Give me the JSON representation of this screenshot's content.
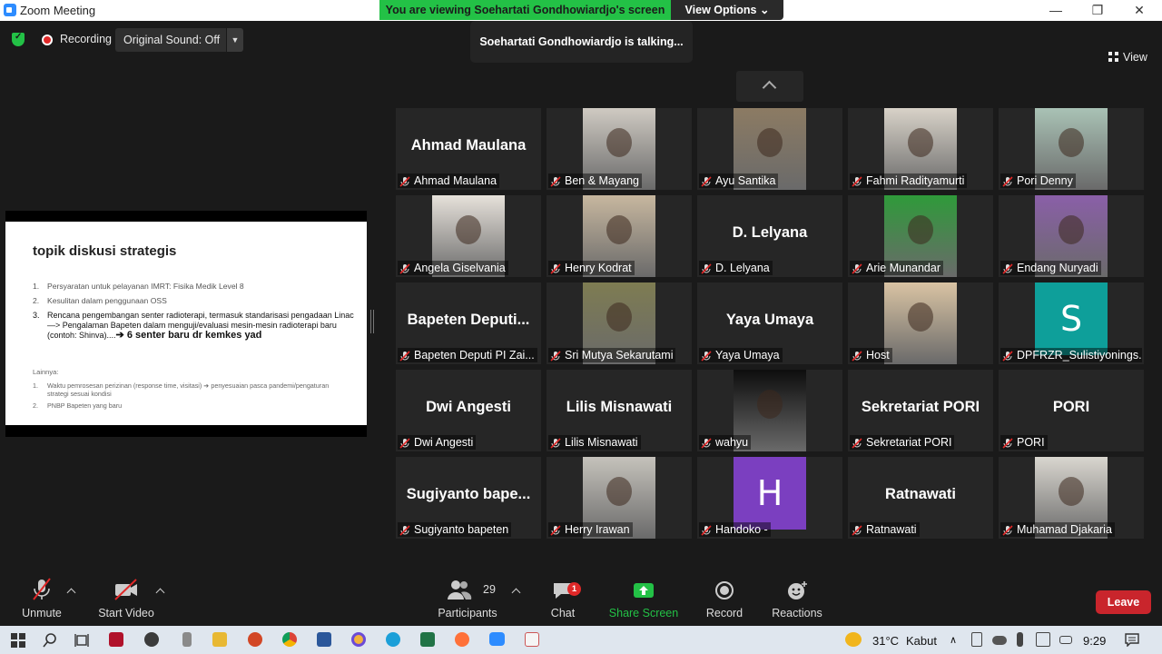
{
  "window": {
    "title": "Zoom Meeting"
  },
  "share_banner": {
    "text": "You are viewing Soehartati Gondhowiardjo's screen",
    "view_options": "View Options ⌄"
  },
  "topbar": {
    "recording_label": "Recording",
    "original_sound": "Original Sound: Off",
    "talking": "Soehartati Gondhowiardjo is talking...",
    "view_label": "View"
  },
  "slide": {
    "title": "topik diskusi strategis",
    "items": [
      {
        "num": "1.",
        "text": "Persyaratan untuk pelayanan IMRT: Fisika Medik Level 8"
      },
      {
        "num": "2.",
        "text": "Kesulitan dalam penggunaan OSS"
      },
      {
        "num": "3.",
        "text": "Rencana pengembangan senter radioterapi, termasuk standarisasi pengadaan Linac —> Pengalaman Bapeten dalam menguji/evaluasi mesin-mesin radioterapi baru (contoh: Shinva)....",
        "emphasis": "➔ 6 senter baru dr kemkes yad"
      }
    ],
    "lainnya_label": "Lainnya:",
    "sub_items": [
      {
        "num": "1.",
        "text": "Waktu pemrosesan perizinan (response time, visitasi) ➔ penyesuaian pasca pandemi/pengaturan strategi sesuai kondisi"
      },
      {
        "num": "2.",
        "text": "PNBP Bapeten yang baru"
      }
    ]
  },
  "participants": [
    {
      "label": "Ahmad Maulana",
      "big": "Ahmad Maulana",
      "kind": "name"
    },
    {
      "label": "Ben & Mayang",
      "kind": "video",
      "color": "#cfcac2"
    },
    {
      "label": "Ayu Santika",
      "kind": "video",
      "color": "#8c7b63"
    },
    {
      "label": "Fahmi Radityamurti",
      "kind": "video",
      "color": "#d8d2c8"
    },
    {
      "label": "Pori Denny",
      "kind": "video",
      "color": "#a9c2b5"
    },
    {
      "label": "Angela Giselvania",
      "kind": "video",
      "color": "#e6e1da"
    },
    {
      "label": "Henry Kodrat",
      "kind": "video",
      "color": "#c7b79f"
    },
    {
      "label": "D. Lelyana",
      "big": "D. Lelyana",
      "kind": "name"
    },
    {
      "label": "Arie Munandar",
      "kind": "video",
      "color": "#2f9a3a"
    },
    {
      "label": "Endang Nuryadi",
      "kind": "video",
      "color": "#8a5fa8"
    },
    {
      "label": "Bapeten Deputi PI Zai...",
      "big": "Bapeten  Deputi...",
      "kind": "name"
    },
    {
      "label": "Sri Mutya Sekarutami",
      "kind": "video",
      "color": "#7e7c52"
    },
    {
      "label": "Yaya Umaya",
      "big": "Yaya Umaya",
      "kind": "name"
    },
    {
      "label": "Host",
      "kind": "video",
      "color": "#d9c3a3"
    },
    {
      "label": "DPFRZR_Sulistiyonings...",
      "kind": "letter",
      "letter": "S",
      "color": "#0e9f9a"
    },
    {
      "label": "Dwi Angesti",
      "big": "Dwi Angesti",
      "kind": "name"
    },
    {
      "label": "Lilis Misnawati",
      "big": "Lilis Misnawati",
      "kind": "name"
    },
    {
      "label": "wahyu",
      "kind": "video",
      "color": "#0d0d0d"
    },
    {
      "label": "Sekretariat PORI",
      "big": "Sekretariat PORI",
      "kind": "name"
    },
    {
      "label": "PORI",
      "big": "PORI",
      "kind": "name"
    },
    {
      "label": "Sugiyanto bapeten",
      "big": "Sugiyanto  bape...",
      "kind": "name"
    },
    {
      "label": "Herry Irawan",
      "kind": "video",
      "color": "#c5c2bb"
    },
    {
      "label": "Handoko -",
      "kind": "letter",
      "letter": "H",
      "color": "#7b3fc0"
    },
    {
      "label": "Ratnawati",
      "big": "Ratnawati",
      "kind": "name"
    },
    {
      "label": "Muhamad Djakaria",
      "kind": "video",
      "color": "#d9d6cf"
    }
  ],
  "toolbar": {
    "unmute": "Unmute",
    "start_video": "Start Video",
    "participants": "Participants",
    "participant_count": "29",
    "chat": "Chat",
    "chat_badge": "1",
    "share_screen": "Share Screen",
    "record": "Record",
    "reactions": "Reactions",
    "leave": "Leave"
  },
  "taskbar": {
    "temperature": "31°C",
    "weather": "Kabut",
    "time": "9:29"
  },
  "colors": {
    "accent_green": "#23c146",
    "leave_red": "#c9252c",
    "share_green": "#23c146"
  }
}
